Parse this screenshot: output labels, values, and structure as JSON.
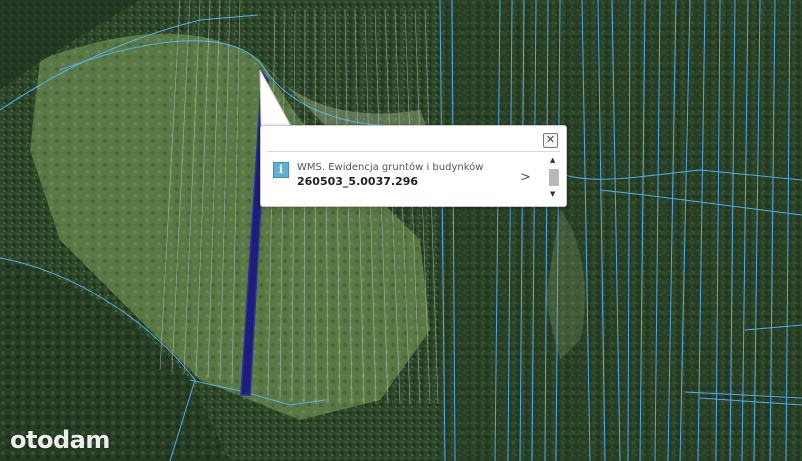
{
  "popup": {
    "close_label": "✕",
    "info_icon": "i",
    "layer_name": "WMS. Ewidencja gruntów i budynków",
    "parcel_id": "260503_5.0037.296",
    "chevron": ">",
    "scroll_up": "▲",
    "scroll_down": "▼"
  },
  "watermark": {
    "text": "otodam"
  },
  "colors": {
    "parcel_highlight": "#1c1f7a",
    "parcel_boundaries": "#5bb4ff",
    "forest_dark": "#243b22",
    "meadow": "#5c7a45"
  }
}
